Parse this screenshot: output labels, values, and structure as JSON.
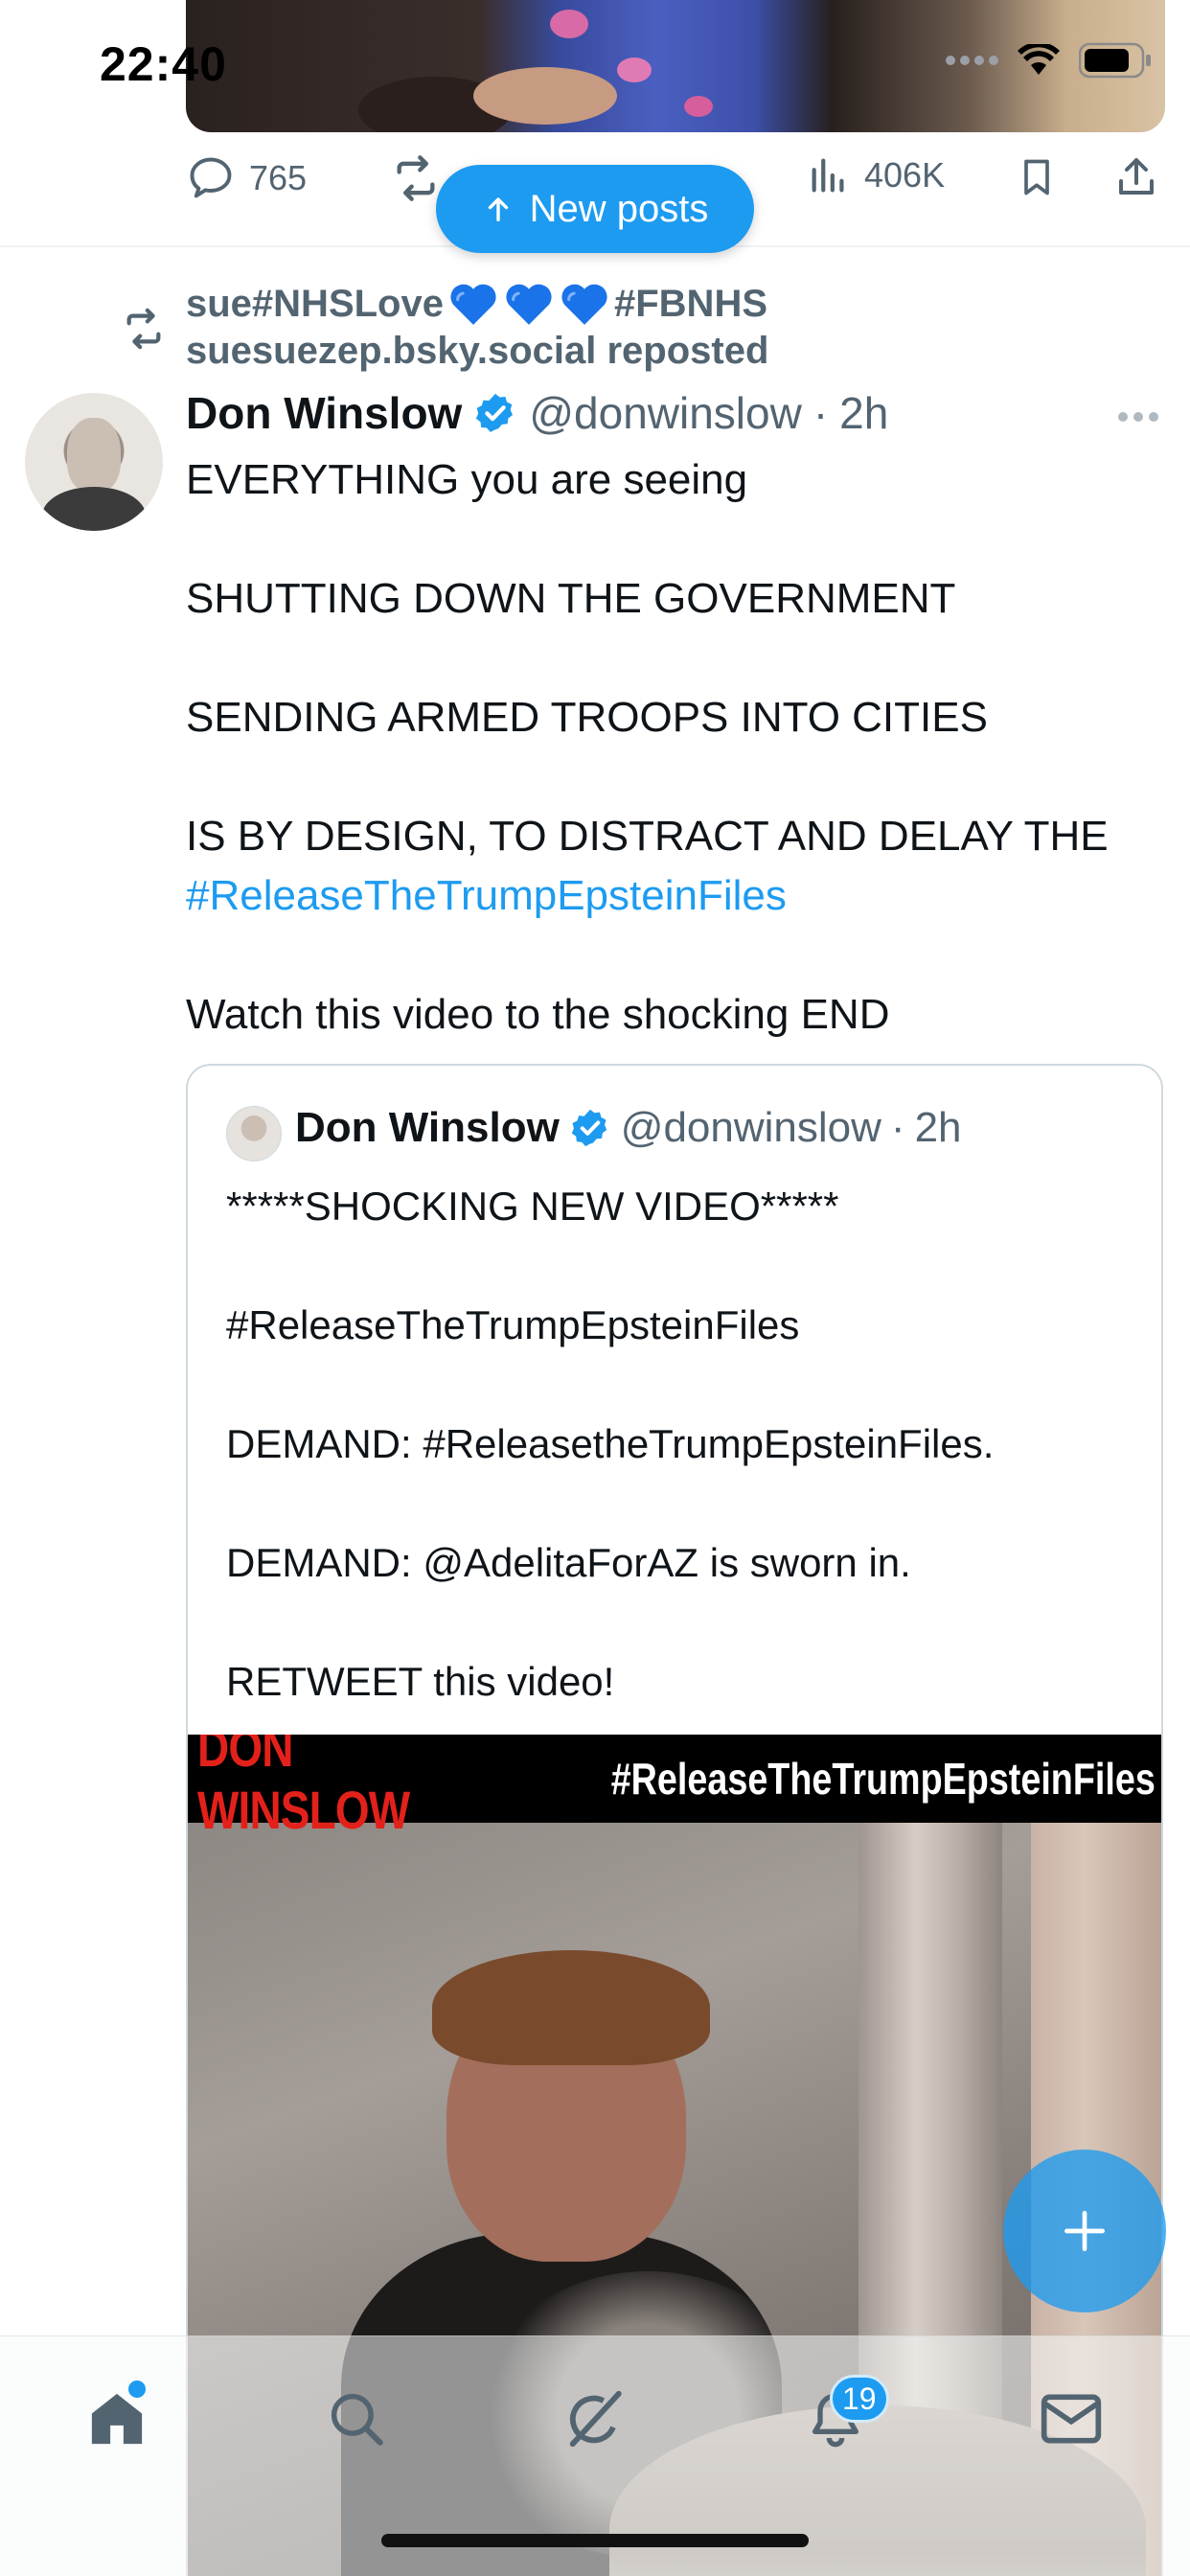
{
  "status_bar": {
    "time": "22:40"
  },
  "previous_post": {
    "reply_count": "765",
    "views_count": "406K"
  },
  "new_posts_pill": {
    "label": "New posts"
  },
  "repost_header": {
    "line1_prefix": "sue#NHSLove",
    "line1_suffix": "#FBNHS",
    "line2": "suesuezep.bsky.social reposted"
  },
  "post": {
    "author_name": "Don Winslow",
    "author_handle": "@donwinslow",
    "separator": "·",
    "time": "2h",
    "lines": [
      "EVERYTHING you are seeing",
      "SHUTTING DOWN THE GOVERNMENT",
      "SENDING ARMED TROOPS INTO CITIES",
      "IS BY DESIGN, TO DISTRACT AND DELAY THE"
    ],
    "hashtag": "#ReleaseTheTrumpEpsteinFiles",
    "closing_line": "Watch this video to the shocking END"
  },
  "quoted_post": {
    "author_name": "Don Winslow",
    "author_handle": "@donwinslow",
    "separator": "·",
    "time": "2h",
    "lines": [
      "*****SHOCKING NEW VIDEO*****",
      "#ReleaseTheTrumpEpsteinFiles",
      "DEMAND: #ReleasetheTrumpEpsteinFiles.",
      "DEMAND: @AdelitaForAZ is sworn in.",
      "RETWEET this video!"
    ],
    "video_banner_left": "DON WINSLOW",
    "video_banner_right": "#ReleaseTheTrumpEpsteinFiles"
  },
  "bottom_nav": {
    "notifications_badge": "19"
  },
  "colors": {
    "accent": "#1d9bf0",
    "secondary_text": "#536471",
    "primary_text": "#0f1419",
    "banner_red": "#e3211b"
  },
  "icons": {
    "reply": "speech-bubble-icon",
    "repost": "repost-arrows-icon",
    "views": "bar-chart-icon",
    "bookmark": "bookmark-icon",
    "share": "share-upload-icon",
    "more": "ellipsis-icon",
    "verified": "verified-badge-icon",
    "heart": "blue-heart-icon",
    "home": "home-icon",
    "search": "search-icon",
    "grok": "grok-slash-icon",
    "notifications": "bell-icon",
    "messages": "envelope-icon",
    "compose": "plus-icon"
  }
}
